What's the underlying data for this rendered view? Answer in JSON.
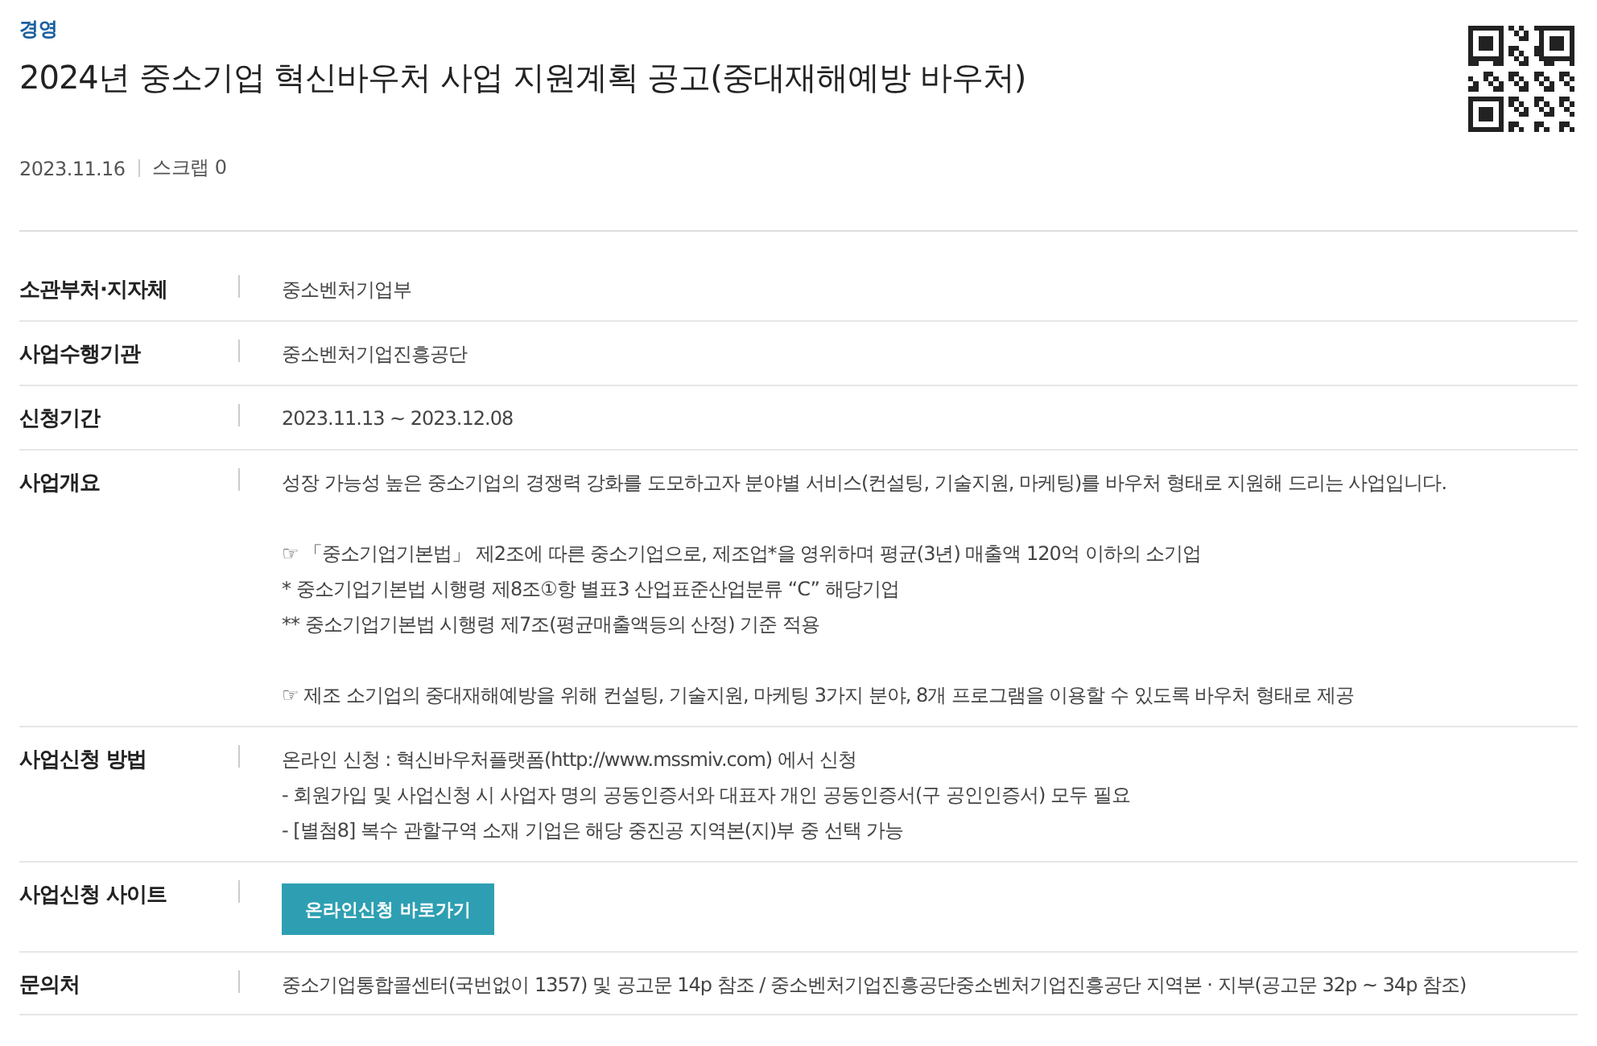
{
  "category": "경영",
  "title": "2024년 중소기업 혁신바우처 사업 지원계획 공고(중대재해예방 바우처)",
  "date": "2023.11.16",
  "scrap": "스크랩 0",
  "rows": [
    {
      "kind": "text",
      "label": "소관부처·지자체",
      "paragraphs": [
        [
          "중소벤처기업부"
        ]
      ]
    },
    {
      "kind": "text",
      "label": "사업수행기관",
      "paragraphs": [
        [
          "중소벤처기업진흥공단"
        ]
      ]
    },
    {
      "kind": "text",
      "label": "신청기간",
      "paragraphs": [
        [
          "2023.11.13 ~ 2023.12.08"
        ]
      ]
    },
    {
      "kind": "text",
      "label": "사업개요",
      "paragraphs": [
        [
          "성장 가능성 높은 중소기업의 경쟁력 강화를 도모하고자 분야별 서비스(컨설팅, 기술지원, 마케팅)를 바우처 형태로 지원해 드리는 사업입니다."
        ],
        [
          "☞ 「중소기업기본법」 제2조에 따른 중소기업으로, 제조업*을 영위하며 평균(3년) 매출액 120억 이하의 소기업",
          " * 중소기업기본법 시행령 제8조①항 별표3 산업표준산업분류 “C” 해당기업",
          " ** 중소기업기본법 시행령 제7조(평균매출액등의 산정) 기준 적용"
        ],
        [
          "☞ 제조 소기업의 중대재해예방을 위해 컨설팅, 기술지원, 마케팅 3가지 분야, 8개 프로그램을 이용할 수 있도록 바우처 형태로 제공"
        ]
      ]
    },
    {
      "kind": "text",
      "label": "사업신청 방법",
      "paragraphs": [
        [
          "온라인 신청 : 혁신바우처플랫폼(http://www.mssmiv.com) 에서 신청",
          "- 회원가입 및 사업신청 시 사업자 명의 공동인증서와 대표자 개인 공동인증서(구 공인인증서) 모두 필요",
          "- [별첨8] 복수 관할구역 소재 기업은 해당 중진공 지역본(지)부 중 선택 가능"
        ]
      ]
    },
    {
      "kind": "button",
      "label": "사업신청 사이트",
      "button": "온라인신청 바로가기"
    },
    {
      "kind": "text",
      "label": "문의처",
      "paragraphs": [
        [
          "중소기업통합콜센터(국번없이 1357) 및 공고문 14p 참조 / 중소벤처기업진흥공단중소벤처기업진흥공단 지역본 · 지부(공고문 32p ~ 34p 참조)"
        ]
      ]
    }
  ]
}
